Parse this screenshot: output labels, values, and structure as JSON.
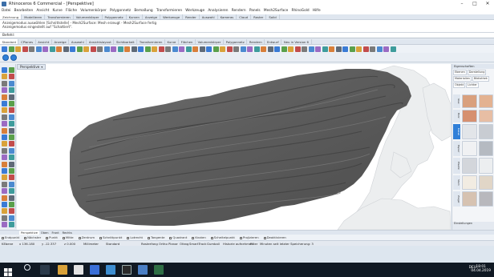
{
  "window": {
    "title": "Rhinoceros 6 Commercial - [Perspektive]"
  },
  "menubar": [
    "Datei",
    "Bearbeiten",
    "Ansicht",
    "Kurve",
    "Fläche",
    "Volumenkörper",
    "Polygonnetz",
    "Bemaßung",
    "Transformieren",
    "Werkzeuge",
    "Analysieren",
    "Rendern",
    "Panels",
    "Mesh2Surface",
    "RhinoGold",
    "Hilfe"
  ],
  "command_tabs": [
    "Zeichnung",
    "Modellieren",
    "Transformieren",
    "Volumenkörper",
    "Polygonnetz",
    "Kurven",
    "Anzeige",
    "Werkzeuge",
    "Render",
    "Auswahl",
    "Kameras",
    "Cloud",
    "Raster",
    "Solid"
  ],
  "command_history": {
    "line1": "Anzeigemodus auswählen [Schnittstelle] - Mesh2Surface: Mesh erzeugt - Mesh2Surface fertig",
    "line2": "Anzeigemodus eingestellt auf \"Schattiert\"."
  },
  "command_prompt": "Befehl:",
  "toolbar_tabs": [
    "Standard",
    "CPlanes",
    "Ansicht",
    "Anzeige",
    "Auswahl",
    "Ansichtslayout",
    "Sichtbarkeit",
    "Transformieren",
    "Kurve",
    "Flächen",
    "Volumenkörper",
    "Polygonnetz",
    "Rendern",
    "Entwurf",
    "Neu in Version 6"
  ],
  "viewport": {
    "tab_label": "Perspektive",
    "tab_arrow": "▾"
  },
  "right_panel": {
    "title": "Eigenschaften",
    "tabs": [
      "Ebenen",
      "Darstellung",
      "Materialien",
      "Bibliothek",
      "Objekt",
      "Lichter"
    ],
    "categories": [
      "Glas",
      "Holz",
      "Metall",
      "Papier",
      "Plastik",
      "Stein",
      "Ziegel",
      "Kunststoff",
      "Fliesen"
    ],
    "selected_category": "Metall",
    "swatches": [
      "#d9a07d",
      "#e3b291",
      "#d69070",
      "#e7bea4",
      "#e2e5e9",
      "#c8ccd2",
      "#f0f1f3",
      "#b5bac1",
      "#d3d6db",
      "#eceef0",
      "#f2ece2",
      "#e1d6c7",
      "#d6c2b1",
      "#b8b8bd"
    ],
    "footer_label": "Einstellungen"
  },
  "viewport_tabs": [
    "Perspektive",
    "Oben",
    "Front",
    "Rechts"
  ],
  "osnap": {
    "items": [
      "Endpunkt",
      "Nächster",
      "Punkt",
      "Mitte",
      "Zentrum",
      "Schnittpunkt",
      "Lotrecht",
      "Tangente",
      "Quadrant",
      "Knoten",
      "Scheitelpunkt",
      "Projizieren",
      "Deaktivieren"
    ]
  },
  "status_bar": {
    "cplane": "KEbene",
    "x": "x 136.180",
    "y": "y -12.337",
    "z": "z 0.000",
    "units": "Millimeter",
    "layer": "Standard",
    "toggles": [
      "Rasterfang",
      "Ortho",
      "Planar",
      "Ofang",
      "SmartTrack",
      "Gumball",
      "Historie aufnehmen",
      "Filter"
    ],
    "message": "Minuten seit letzter Speicherung: 3"
  },
  "taskbar": {
    "tray_lang": "DEU",
    "time": "18:01",
    "date": "04.04.2019"
  }
}
